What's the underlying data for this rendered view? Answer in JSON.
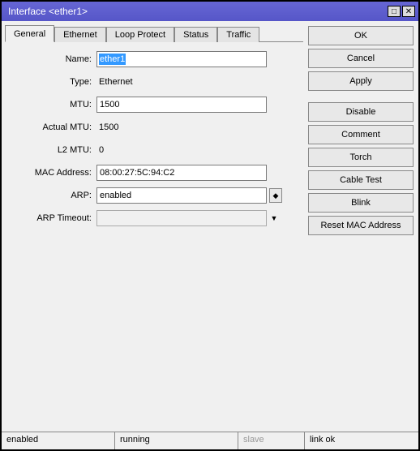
{
  "window": {
    "title": "Interface <ether1>"
  },
  "tabs": {
    "t0": "General",
    "t1": "Ethernet",
    "t2": "Loop Protect",
    "t3": "Status",
    "t4": "Traffic"
  },
  "labels": {
    "name": "Name:",
    "type": "Type:",
    "mtu": "MTU:",
    "actual_mtu": "Actual MTU:",
    "l2_mtu": "L2 MTU:",
    "mac": "MAC Address:",
    "arp": "ARP:",
    "arp_timeout": "ARP Timeout:"
  },
  "values": {
    "name": "ether1",
    "type": "Ethernet",
    "mtu": "1500",
    "actual_mtu": "1500",
    "l2_mtu": "0",
    "mac": "08:00:27:5C:94:C2",
    "arp": "enabled",
    "arp_timeout": ""
  },
  "buttons": {
    "ok": "OK",
    "cancel": "Cancel",
    "apply": "Apply",
    "disable": "Disable",
    "comment": "Comment",
    "torch": "Torch",
    "cable_test": "Cable Test",
    "blink": "Blink",
    "reset_mac": "Reset MAC Address"
  },
  "status": {
    "s0": "enabled",
    "s1": "running",
    "s2": "slave",
    "s3": "link ok"
  }
}
